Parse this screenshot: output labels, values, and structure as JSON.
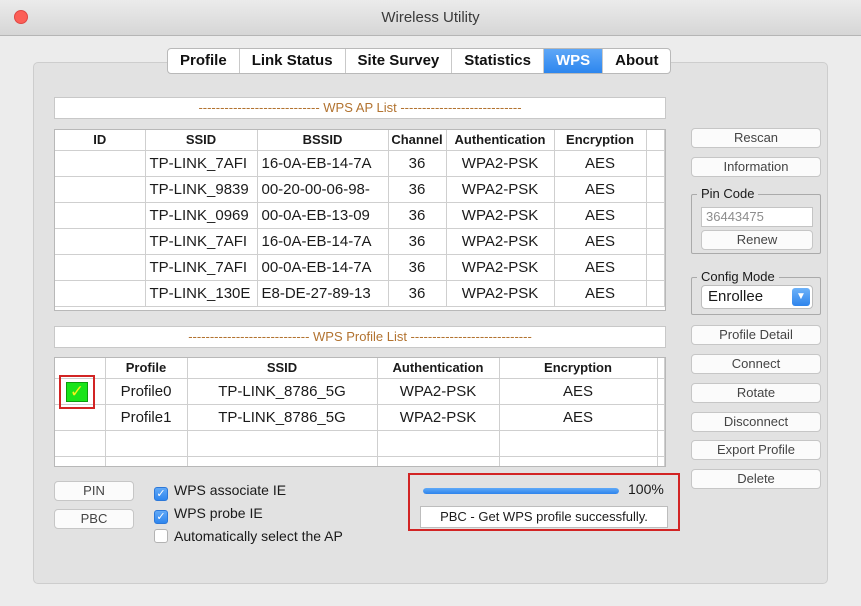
{
  "window": {
    "title": "Wireless Utility"
  },
  "tabs": [
    "Profile",
    "Link Status",
    "Site Survey",
    "Statistics",
    "WPS",
    "About"
  ],
  "active_tab": "WPS",
  "ap_list": {
    "title": "---------------------------- WPS AP List ----------------------------",
    "columns": [
      "ID",
      "SSID",
      "BSSID",
      "Channel",
      "Authentication",
      "Encryption"
    ],
    "rows": [
      [
        "",
        "TP-LINK_7AFI",
        "16-0A-EB-14-7A",
        "36",
        "WPA2-PSK",
        "AES"
      ],
      [
        "",
        "TP-LINK_9839",
        "00-20-00-06-98-",
        "36",
        "WPA2-PSK",
        "AES"
      ],
      [
        "",
        "TP-LINK_0969",
        "00-0A-EB-13-09",
        "36",
        "WPA2-PSK",
        "AES"
      ],
      [
        "",
        "TP-LINK_7AFI",
        "16-0A-EB-14-7A",
        "36",
        "WPA2-PSK",
        "AES"
      ],
      [
        "",
        "TP-LINK_7AFI",
        "00-0A-EB-14-7A",
        "36",
        "WPA2-PSK",
        "AES"
      ],
      [
        "",
        "TP-LINK_130E",
        "E8-DE-27-89-13",
        "36",
        "WPA2-PSK",
        "AES"
      ]
    ]
  },
  "profile_list": {
    "title": "---------------------------- WPS Profile List ----------------------------",
    "columns": [
      "",
      "Profile",
      "SSID",
      "Authentication",
      "Encryption"
    ],
    "rows": [
      [
        "",
        "Profile0",
        "TP-LINK_8786_5G",
        "WPA2-PSK",
        "AES"
      ],
      [
        "",
        "Profile1",
        "TP-LINK_8786_5G",
        "WPA2-PSK",
        "AES"
      ]
    ]
  },
  "side": {
    "rescan": "Rescan",
    "information": "Information",
    "pin_code_label": "Pin Code",
    "pin_code_value": "36443475",
    "renew": "Renew",
    "config_mode_label": "Config Mode",
    "config_mode_value": "Enrollee",
    "profile_detail": "Profile Detail",
    "connect": "Connect",
    "rotate": "Rotate",
    "disconnect": "Disconnect",
    "export_profile": "Export Profile",
    "delete": "Delete"
  },
  "bottom": {
    "pin": "PIN",
    "pbc": "PBC",
    "checkboxes": [
      {
        "label": "WPS associate IE",
        "checked": true
      },
      {
        "label": "WPS probe IE",
        "checked": true
      },
      {
        "label": "Automatically select the AP",
        "checked": false
      }
    ],
    "progress_percent": 100,
    "progress_label": "100%",
    "status": "PBC - Get WPS profile successfully."
  },
  "colors": {
    "accent": "#2e84ec",
    "highlight": "#d22424",
    "section_title": "#b27330"
  }
}
